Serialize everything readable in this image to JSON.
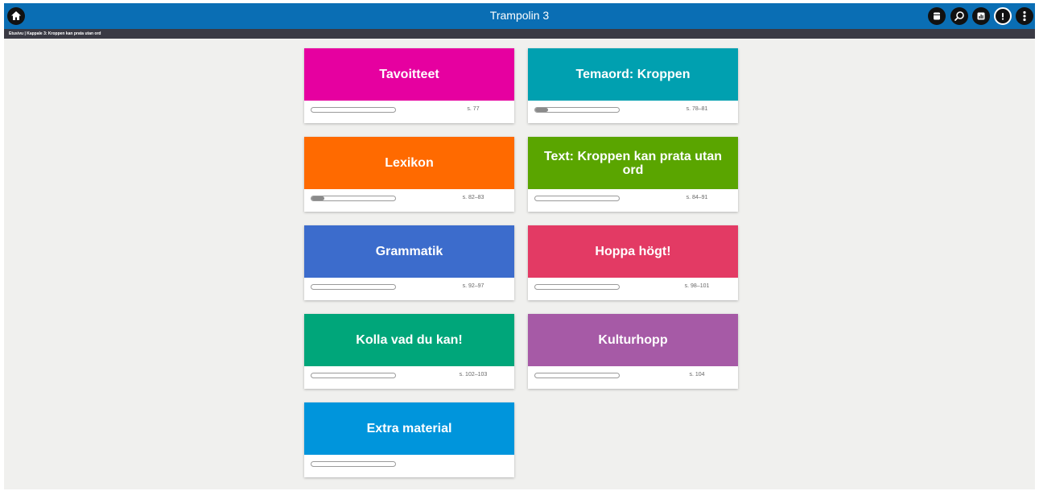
{
  "header": {
    "title": "Trampolin 3",
    "breadcrumb": "Etusivu | Kappale 3: Kroppen kan prata utan ord",
    "icons": [
      "home-icon",
      "notebook-icon",
      "search-icon",
      "report-icon",
      "alert-icon",
      "more-icon"
    ]
  },
  "cards": [
    {
      "title": "Tavoitteet",
      "pages": "s. 77",
      "color": "#e600a0",
      "progress": 0
    },
    {
      "title": "Temaord: Kroppen",
      "pages": "s. 78–81",
      "color": "#00a0b0",
      "progress": 0.15
    },
    {
      "title": "Lexikon",
      "pages": "s. 82–83",
      "color": "#ff6a00",
      "progress": 0.15
    },
    {
      "title": "Text: Kroppen kan prata utan ord",
      "pages": "s. 84–91",
      "color": "#5aa500",
      "progress": 0
    },
    {
      "title": "Grammatik",
      "pages": "s. 92–97",
      "color": "#3c6ccc",
      "progress": 0
    },
    {
      "title": "Hoppa högt!",
      "pages": "s. 98–101",
      "color": "#e33a64",
      "progress": 0
    },
    {
      "title": "Kolla vad du kan!",
      "pages": "s. 102–103",
      "color": "#00a67a",
      "progress": 0
    },
    {
      "title": "Kulturhopp",
      "pages": "s. 104",
      "color": "#a65aa6",
      "progress": 0
    },
    {
      "title": "Extra material",
      "pages": "",
      "color": "#0095dc",
      "progress": 0
    }
  ]
}
